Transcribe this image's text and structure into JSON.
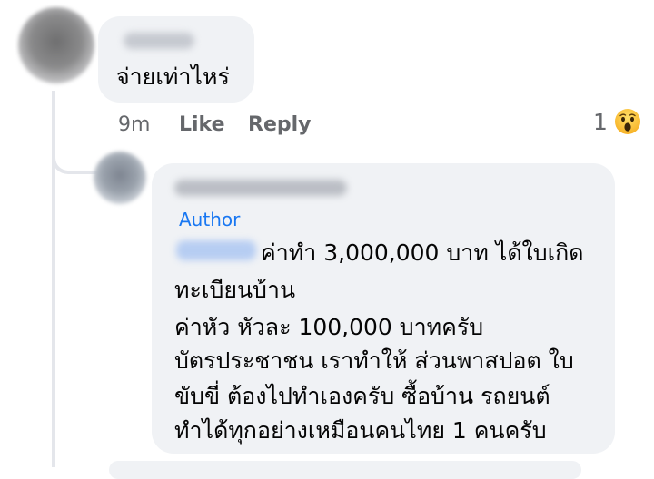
{
  "comment": {
    "text": "จ่ายเท่าไหร่",
    "time": "9m",
    "like_label": "Like",
    "reply_label": "Reply",
    "reaction_count": "1",
    "reaction_icon": "wow-emoji-icon"
  },
  "reply": {
    "badge": "Author",
    "lines": [
      "ค่าทำ 3,000,000 บาท ได้ใบเกิด",
      "ทะเบียนบ้าน",
      "ค่าหัว หัวละ 100,000 บาทครับ",
      "บัตรประชาชน เราทำให้ ส่วนพาสปอต ใบ",
      "ขับขี่ ต้องไปทำเองครับ ซื้อบ้าน รถยนต์",
      "ทำได้ทุกอย่างเหมือนคนไทย 1 คนครับ"
    ]
  },
  "colors": {
    "bubble": "#f0f2f5",
    "meta_text": "#65676b",
    "author_badge": "#1877f2"
  }
}
